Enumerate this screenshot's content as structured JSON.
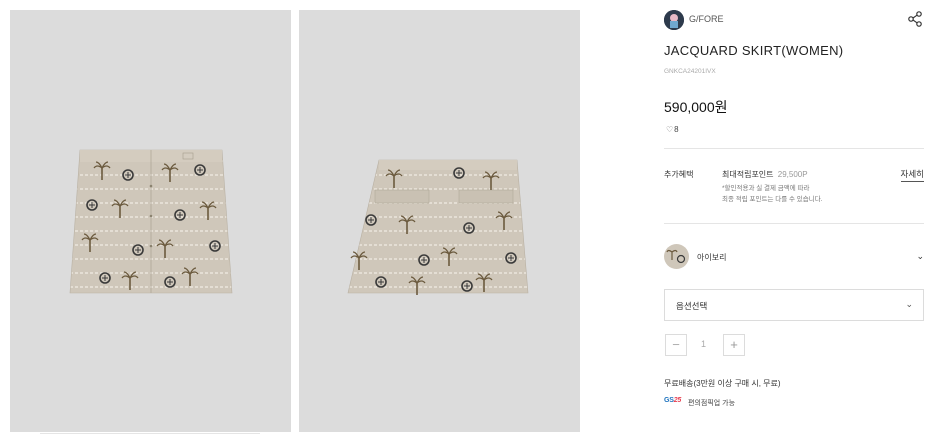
{
  "brand": {
    "name": "G/FORE"
  },
  "product": {
    "title": "JACQUARD SKIRT(WOMEN)",
    "code": "GNKCA24201IVX",
    "price": "590,000원",
    "likes": "8"
  },
  "benefits": {
    "label": "추가혜택",
    "main": "최대적립포인트",
    "points": "29,500P",
    "note_line1": "*할인적용과 실 결제 금액에 따라",
    "note_line2": "최종 적립 포인트는 다를 수 있습니다.",
    "detail_link": "자세히"
  },
  "color_option": {
    "name": "아이보리"
  },
  "option_select": {
    "label": "옵션선택"
  },
  "quantity": {
    "minus": "−",
    "value": "1",
    "plus": "+"
  },
  "shipping": {
    "text": "무료배송(3만원 이상 구매 시, 무료)"
  },
  "pickup": {
    "logo_a": "GS",
    "logo_b": "25",
    "text": "편의점픽업 가능"
  },
  "icons": {
    "share": "share-icon",
    "heart": "heart-icon",
    "color_chevron": "chevron-down-icon",
    "select_chevron": "chevron-down-icon"
  },
  "colors": {
    "photo_bg": "#dcdcdc",
    "skirt_fabric": "#cfc7ba",
    "palm_motif": "#6b5a3e",
    "medallion_motif": "#3a3a3a",
    "brand_logo_bg": "#2d3a4c",
    "gs_blue": "#1e73be",
    "gs_red": "#e83e50"
  }
}
